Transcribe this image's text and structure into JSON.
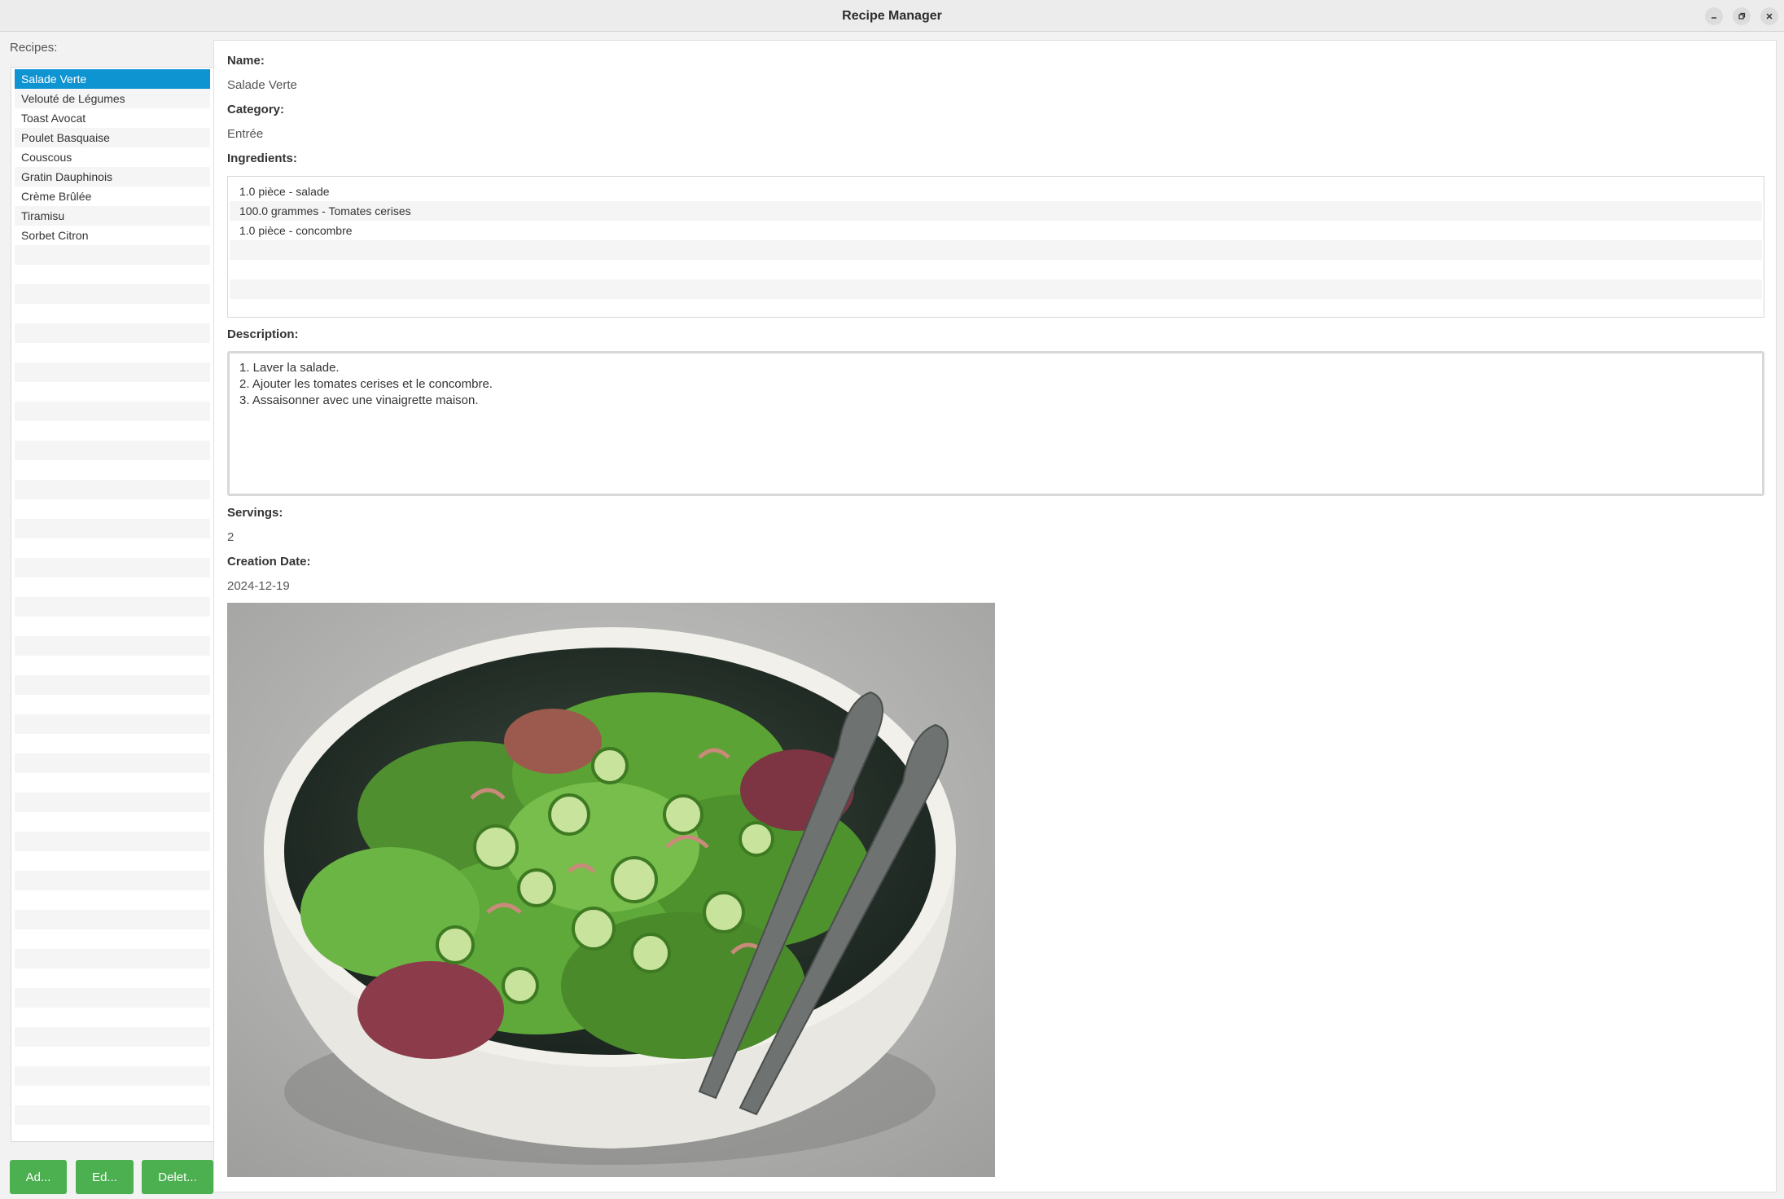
{
  "window": {
    "title": "Recipe Manager",
    "minimize_icon": "minimize-icon",
    "maximize_icon": "restore-icon",
    "close_icon": "close-icon"
  },
  "sidebar": {
    "label": "Recipes:",
    "items": [
      {
        "label": "Salade Verte",
        "selected": true
      },
      {
        "label": "Velouté de Légumes"
      },
      {
        "label": "Toast Avocat"
      },
      {
        "label": "Poulet Basquaise"
      },
      {
        "label": "Couscous"
      },
      {
        "label": "Gratin Dauphinois"
      },
      {
        "label": "Crème Brûlée"
      },
      {
        "label": "Tiramisu"
      },
      {
        "label": "Sorbet Citron"
      }
    ],
    "selected_color": "#0f94d2"
  },
  "buttons": {
    "add_label": "Ad...",
    "edit_label": "Ed...",
    "delete_label": "Delet...",
    "color": "#4caf50"
  },
  "detail": {
    "name_label": "Name:",
    "name_value": "Salade Verte",
    "category_label": "Category:",
    "category_value": "Entrée",
    "ingredients_label": "Ingredients:",
    "ingredients": [
      "1.0 pièce - salade",
      "100.0 grammes - Tomates cerises",
      "1.0 pièce - concombre"
    ],
    "description_label": "Description:",
    "description_lines": [
      "1. Laver la salade.",
      "2. Ajouter les tomates cerises et le concombre.",
      "3. Assaisonner avec une vinaigrette maison."
    ],
    "servings_label": "Servings:",
    "servings_value": "2",
    "creation_date_label": "Creation Date:",
    "creation_date_value": "2024-12-19"
  }
}
